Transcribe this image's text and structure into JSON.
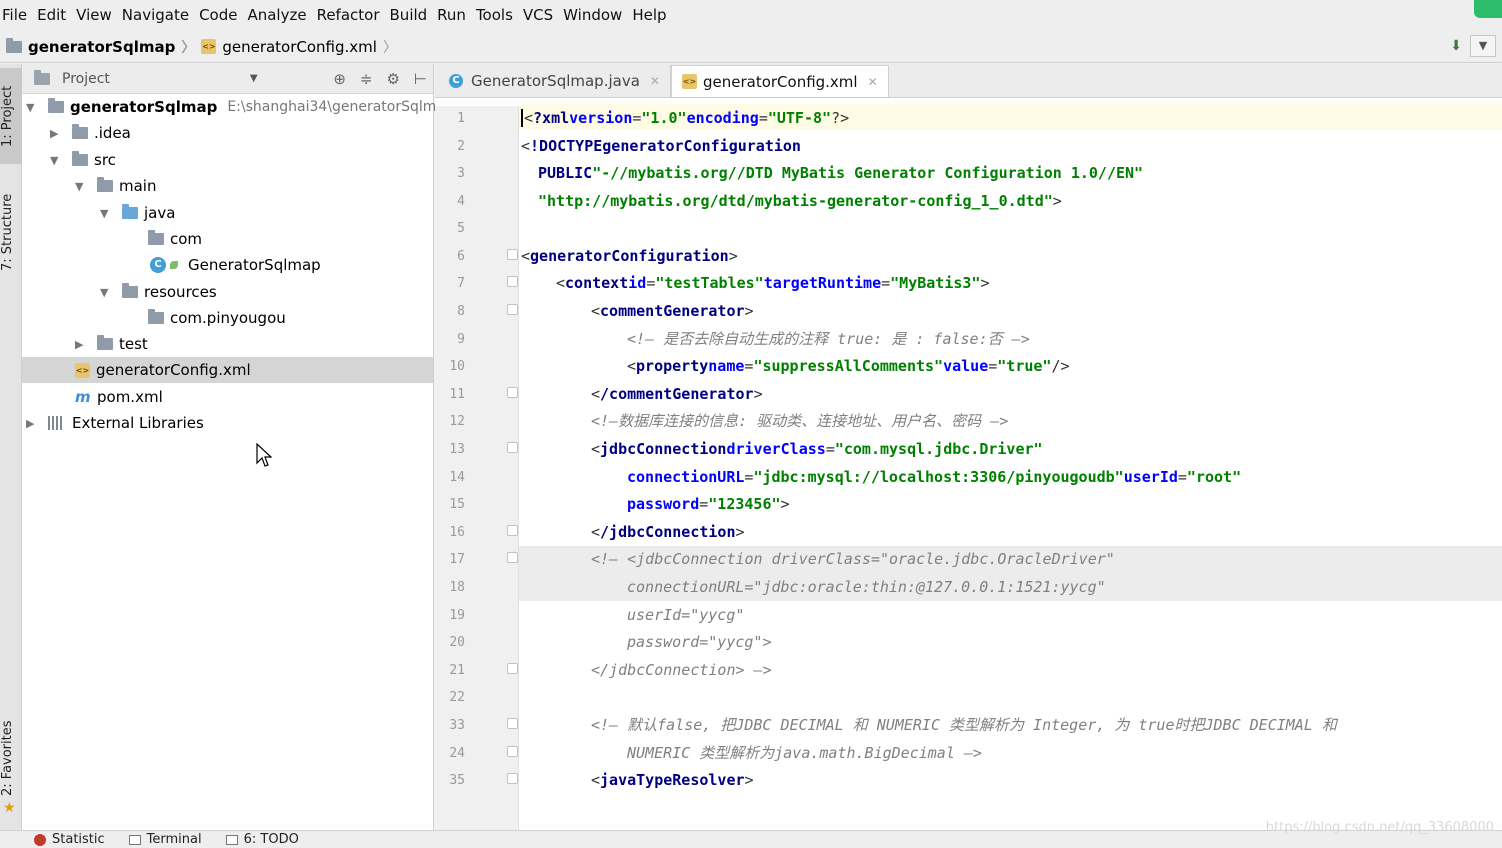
{
  "menu": [
    "File",
    "Edit",
    "View",
    "Navigate",
    "Code",
    "Analyze",
    "Refactor",
    "Build",
    "Run",
    "Tools",
    "VCS",
    "Window",
    "Help"
  ],
  "breadcrumb": {
    "project": "generatorSqlmap",
    "file": "generatorConfig.xml"
  },
  "side_tabs": {
    "project": "1: Project",
    "structure": "7: Structure",
    "favorites": "2: Favorites"
  },
  "project_panel": {
    "title": "Project",
    "tree": [
      {
        "label": "generatorSqlmap",
        "path": "E:\\shanghai34\\generatorSqlm"
      },
      {
        "label": ".idea"
      },
      {
        "label": "src"
      },
      {
        "label": "main"
      },
      {
        "label": "java"
      },
      {
        "label": "com"
      },
      {
        "label": "GeneratorSqlmap"
      },
      {
        "label": "resources"
      },
      {
        "label": "com.pinyougou"
      },
      {
        "label": "test"
      },
      {
        "label": "generatorConfig.xml"
      },
      {
        "label": "pom.xml"
      },
      {
        "label": "External Libraries"
      }
    ]
  },
  "editor": {
    "tabs": [
      {
        "label": "GeneratorSqlmap.java"
      },
      {
        "label": "generatorConfig.xml"
      }
    ],
    "line_numbers": [
      "1",
      "2",
      "3",
      "4",
      "5",
      "6",
      "7",
      "8",
      "9",
      "10",
      "11",
      "12",
      "13",
      "14",
      "15",
      "16",
      "17",
      "18",
      "19",
      "20",
      "21",
      "22",
      "33",
      "24",
      "35"
    ],
    "code": {
      "l1": {
        "xml": "?xml",
        "v_attr": "version",
        "v_val": "\"1.0\"",
        "e_attr": "encoding",
        "e_val": "\"UTF-8\""
      },
      "l2": {
        "doctype": "!DOCTYPE",
        "name": "generatorConfiguration"
      },
      "l3": {
        "public": "PUBLIC",
        "str": "\"-//mybatis.org//DTD MyBatis Generator Configuration 1.0//EN\""
      },
      "l4": {
        "str": "\"http://mybatis.org/dtd/mybatis-generator-config_1_0.dtd\""
      },
      "l6": {
        "tag": "generatorConfiguration"
      },
      "l7": {
        "tag": "context",
        "a1": "id",
        "v1": "\"testTables\"",
        "a2": "targetRuntime",
        "v2": "\"MyBatis3\""
      },
      "l8": {
        "tag": "commentGenerator"
      },
      "l9": {
        "comment": "!— 是否去除自动生成的注释 true: 是 : false:否 —"
      },
      "l10": {
        "tag": "property",
        "a1": "name",
        "v1": "\"suppressAllComments\"",
        "a2": "value",
        "v2": "\"true\""
      },
      "l11": {
        "tag": "/commentGenerator"
      },
      "l12": {
        "comment": "!—数据库连接的信息: 驱动类、连接地址、用户名、密码 —"
      },
      "l13": {
        "tag": "jdbcConnection",
        "a1": "driverClass",
        "v1": "\"com.mysql.jdbc.Driver\""
      },
      "l14": {
        "a1": "connectionURL",
        "v1": "\"jdbc:mysql://localhost:3306/pinyougoudb\"",
        "a2": "userId",
        "v2": "\"root\""
      },
      "l15": {
        "a1": "password",
        "v1": "\"123456\""
      },
      "l16": {
        "tag": "/jdbcConnection"
      },
      "l17": {
        "comment": "!— <jdbcConnection driverClass=\"oracle.jdbc.OracleDriver\""
      },
      "l18": {
        "comment": "connectionURL=\"jdbc:oracle:thin:@127.0.0.1:1521:yycg\""
      },
      "l19": {
        "comment": "userId=\"yycg\""
      },
      "l20": {
        "comment": "password=\"yycg\">"
      },
      "l21": {
        "comment": "</jdbcConnection> —>"
      },
      "l33": {
        "comment": "!— 默认false, 把JDBC DECIMAL 和 NUMERIC 类型解析为 Integer, 为 true时把JDBC DECIMAL 和"
      },
      "l24": {
        "comment": "NUMERIC 类型解析为java.math.BigDecimal —>"
      },
      "l35": {
        "tag": "javaTypeResolver"
      }
    }
  },
  "status": {
    "statistic": "Statistic",
    "terminal": "Terminal",
    "todo": "6: TODO"
  },
  "watermark": "https://blog.csdn.net/qq_33608000"
}
